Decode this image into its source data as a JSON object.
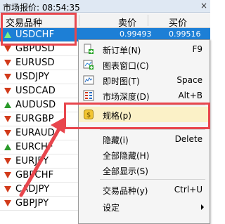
{
  "window": {
    "title": "市场报价: 08:54:35",
    "close": "×"
  },
  "columns": {
    "symbol": "交易品种",
    "bid": "卖价",
    "ask": "买价"
  },
  "selected_values": {
    "bid": "0.99493",
    "ask": "0.99516"
  },
  "symbols": [
    {
      "name": "USDCHF",
      "trend": "up",
      "selected": true
    },
    {
      "name": "GBPUSD",
      "trend": "down"
    },
    {
      "name": "EURUSD",
      "trend": "down"
    },
    {
      "name": "USDJPY",
      "trend": "down"
    },
    {
      "name": "USDCAD",
      "trend": "down"
    },
    {
      "name": "AUDUSD",
      "trend": "up"
    },
    {
      "name": "EURGBP",
      "trend": "down"
    },
    {
      "name": "EURAUD",
      "trend": "down"
    },
    {
      "name": "EURCHF",
      "trend": "up"
    },
    {
      "name": "EURJPY",
      "trend": "down"
    },
    {
      "name": "GBPCHF",
      "trend": "down"
    },
    {
      "name": "CADJPY",
      "trend": "down"
    },
    {
      "name": "GBPJPY",
      "trend": "down"
    }
  ],
  "menu": {
    "new_order": {
      "label": "新订单(N)",
      "key": "F9",
      "icon": "new-order-icon"
    },
    "chart_window": {
      "label": "图表窗口(C)",
      "key": "",
      "icon": "chart-window-icon"
    },
    "tick_chart": {
      "label": "即时图(T)",
      "key": "Space",
      "icon": "tick-chart-icon"
    },
    "market_depth": {
      "label": "市场深度(D)",
      "key": "Alt+B",
      "icon": "market-depth-icon"
    },
    "specification": {
      "label": "规格(p)",
      "key": "",
      "icon": "specification-icon"
    },
    "hide": {
      "label": "隐藏(i)",
      "key": "Delete"
    },
    "hide_all": {
      "label": "全部隐藏(H)",
      "key": ""
    },
    "show_all": {
      "label": "全部显示(S)",
      "key": ""
    },
    "symbols": {
      "label": "交易品种(y)",
      "key": "Ctrl+U"
    },
    "settings": {
      "label": "设定",
      "key": ""
    }
  },
  "colors": {
    "accent": "#1d7fd6",
    "highlight": "#e8464d",
    "up": "#2a9a2a",
    "down": "#d23a1a"
  }
}
